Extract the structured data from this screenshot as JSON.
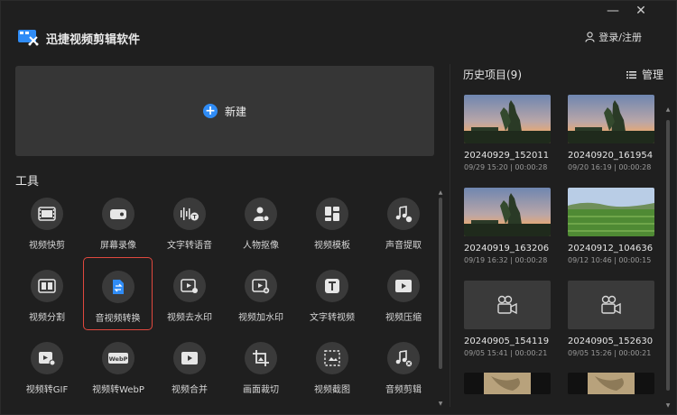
{
  "app": {
    "title": "迅捷视频剪辑软件",
    "login_label": "登录/注册"
  },
  "window_controls": {
    "minimize": "—",
    "close": "✕"
  },
  "new_project": {
    "label": "新建"
  },
  "tools": {
    "title": "工具",
    "items": [
      {
        "label": "视频快剪",
        "icon": "film-icon"
      },
      {
        "label": "屏幕录像",
        "icon": "camera-icon"
      },
      {
        "label": "文字转语音",
        "icon": "text-to-speech-icon"
      },
      {
        "label": "人物抠像",
        "icon": "person-cutout-icon"
      },
      {
        "label": "视频模板",
        "icon": "template-icon"
      },
      {
        "label": "声音提取",
        "icon": "music-extract-icon"
      },
      {
        "label": "视频分割",
        "icon": "split-icon"
      },
      {
        "label": "音视频转换",
        "icon": "convert-icon"
      },
      {
        "label": "视频去水印",
        "icon": "remove-watermark-icon"
      },
      {
        "label": "视频加水印",
        "icon": "add-watermark-icon"
      },
      {
        "label": "文字转视频",
        "icon": "text-to-video-icon"
      },
      {
        "label": "视频压缩",
        "icon": "compress-icon"
      },
      {
        "label": "视频转GIF",
        "icon": "gif-icon"
      },
      {
        "label": "视频转WebP",
        "icon": "webp-icon"
      },
      {
        "label": "视频合并",
        "icon": "merge-icon"
      },
      {
        "label": "画面裁切",
        "icon": "crop-icon"
      },
      {
        "label": "视频截图",
        "icon": "screenshot-icon"
      },
      {
        "label": "音频剪辑",
        "icon": "audio-edit-icon"
      }
    ],
    "selected_index": 7
  },
  "history": {
    "title": "历史项目(9)",
    "manage_label": "管理",
    "items": [
      {
        "name": "20240929_152011",
        "meta": "09/29 15:20 | 00:00:28",
        "thumb": "sky"
      },
      {
        "name": "20240920_161954",
        "meta": "09/20 16:19 | 00:00:28",
        "thumb": "sky"
      },
      {
        "name": "20240919_163206",
        "meta": "09/19 16:32 | 00:00:28",
        "thumb": "sky"
      },
      {
        "name": "20240912_104636",
        "meta": "09/12 10:46 | 00:00:15",
        "thumb": "field"
      },
      {
        "name": "20240905_154119",
        "meta": "09/05 15:41 | 00:00:21",
        "thumb": "placeholder"
      },
      {
        "name": "20240905_152630",
        "meta": "09/05 15:26 | 00:00:21",
        "thumb": "placeholder"
      },
      {
        "name": "",
        "meta": "",
        "thumb": "sand"
      },
      {
        "name": "",
        "meta": "",
        "thumb": "sand"
      }
    ]
  },
  "colors": {
    "accent": "#2f8cf6",
    "selected_border": "#e0483e",
    "panel": "#363636",
    "background": "#1f1f1f"
  }
}
